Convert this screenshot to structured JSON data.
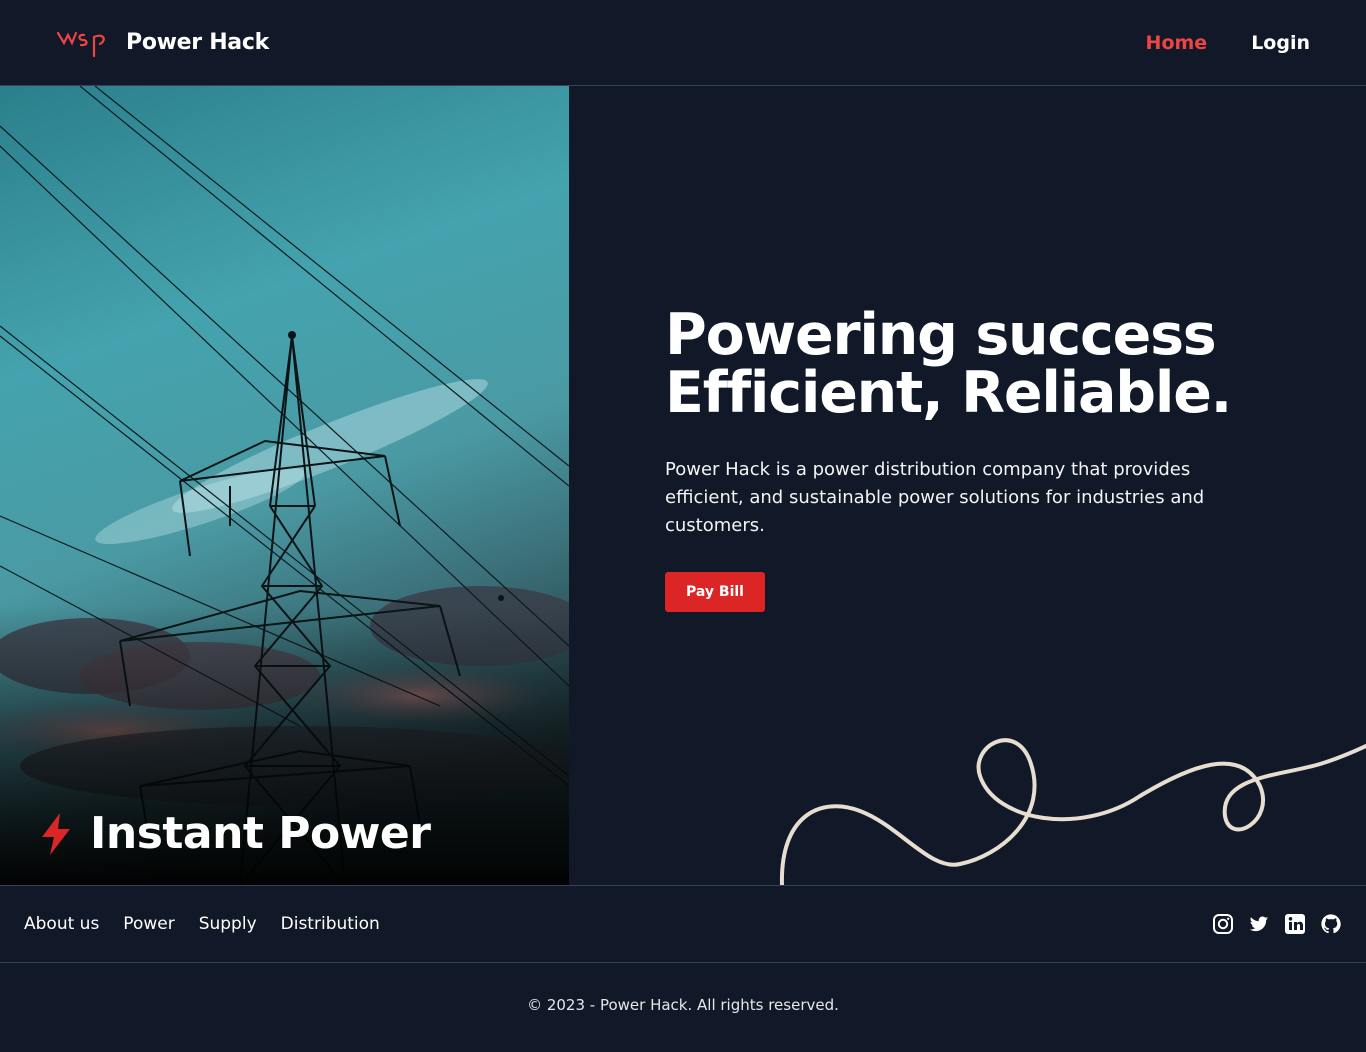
{
  "header": {
    "logo_icon": "wsp-logo-icon",
    "brand_name": "Power Hack",
    "nav": [
      {
        "label": "Home",
        "active": true
      },
      {
        "label": "Login",
        "active": false
      }
    ],
    "accent_color": "#ef4444"
  },
  "hero": {
    "image_caption": "Instant Power",
    "caption_icon": "lightning-bolt-icon",
    "title_line1": "Powering success",
    "title_line2": "Efficient, Reliable.",
    "description": "Power Hack is a power distribution company that provides efficient, and sustainable power solutions for industries and customers.",
    "cta_label": "Pay Bill",
    "cta_color": "#dc2626",
    "background_color": "#111827"
  },
  "footer": {
    "links": [
      "About us",
      "Power",
      "Supply",
      "Distribution"
    ],
    "social_icons": [
      "instagram-icon",
      "twitter-icon",
      "linkedin-icon",
      "github-icon"
    ],
    "copyright": "© 2023 - Power Hack. All rights reserved."
  }
}
